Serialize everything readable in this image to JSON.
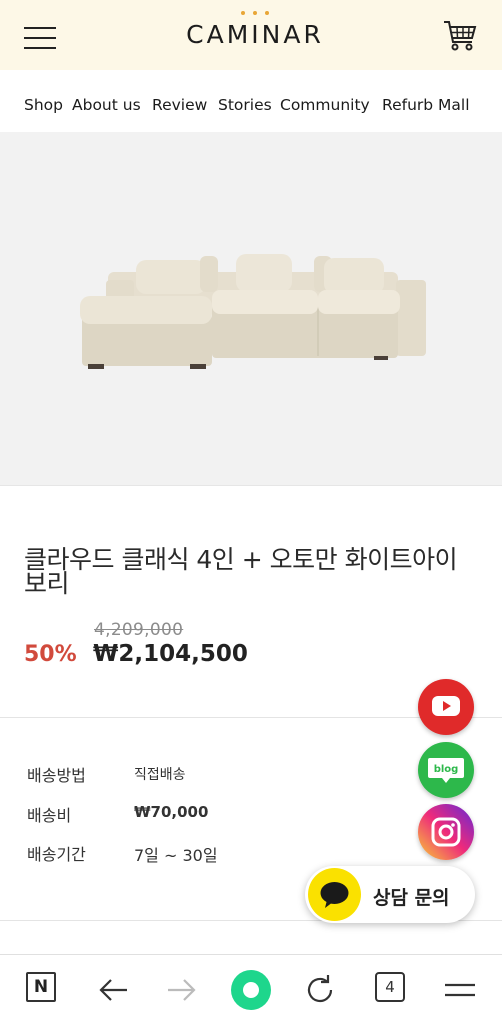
{
  "header": {
    "logo": "CAMINAR"
  },
  "nav": {
    "items": [
      "Shop",
      "About us",
      "Review",
      "Stories",
      "Community",
      "Refurb Mall"
    ]
  },
  "product": {
    "title": "클라우드 클래식 4인 + 오토만 화이트아이보리",
    "original_price": "4,209,000",
    "discount": "50%",
    "sale_price": "₩2,104,500"
  },
  "info": {
    "rows": [
      {
        "label": "배송방법",
        "value": "직접배송"
      },
      {
        "label": "배송비",
        "value": "₩70,000"
      },
      {
        "label": "배송기간",
        "value": "7일 ~ 30일"
      }
    ]
  },
  "floating": {
    "blog_label": "blog",
    "consult_label": "상담 문의"
  },
  "bottom_bar": {
    "tab_count": "4",
    "home_label": "N"
  },
  "colors": {
    "header_bg": "#fdf8e7",
    "discount": "#d14a3c",
    "youtube": "#e02a2a",
    "blog": "#2db84b",
    "kakao": "#fae100",
    "home_accent": "#1ed68c"
  }
}
